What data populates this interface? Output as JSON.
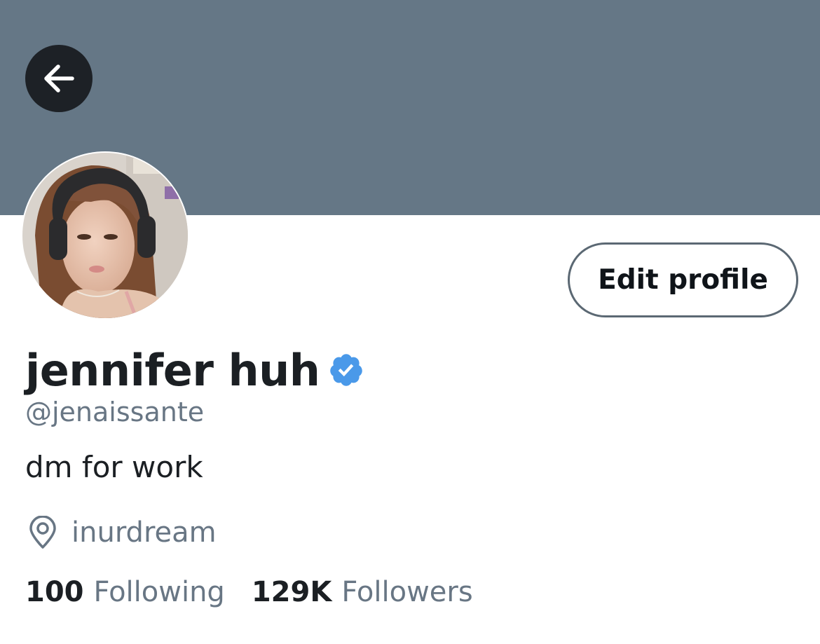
{
  "header": {
    "banner_color": "#657786",
    "back_icon": "arrow-left-icon"
  },
  "profile": {
    "display_name": "jennifer huh",
    "verified_icon": "verified-badge-icon",
    "handle": "@jenaissante",
    "bio": "dm for work",
    "location": "inurdream",
    "location_icon": "map-pin-icon",
    "edit_profile_label": "Edit profile"
  },
  "stats": {
    "following_count": "100",
    "following_label": "Following",
    "followers_count": "129K",
    "followers_label": "Followers"
  },
  "colors": {
    "verified_blue": "#4a99e9",
    "secondary_text": "#687684"
  }
}
